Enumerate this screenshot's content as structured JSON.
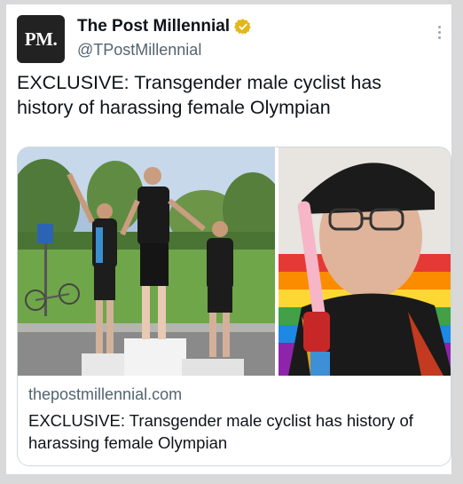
{
  "tweet": {
    "avatar_text": "PM.",
    "display_name": "The Post Millennial",
    "handle": "@TPostMillennial",
    "verified_badge": "verified-gold-check-icon",
    "more_menu": "more-options-icon",
    "text": "EXCLUSIVE: Transgender male cyclist has history of harassing female Olympian"
  },
  "link_card": {
    "domain": "thepostmillennial.com",
    "title": "EXCLUSIVE: Transgender male cyclist has history of harassing female Olympian"
  },
  "colors": {
    "brand_avatar": "#222222",
    "verified_gold": "#e2b719",
    "text_primary": "#0f1419",
    "text_secondary": "#536471",
    "border": "#cfd9de"
  }
}
